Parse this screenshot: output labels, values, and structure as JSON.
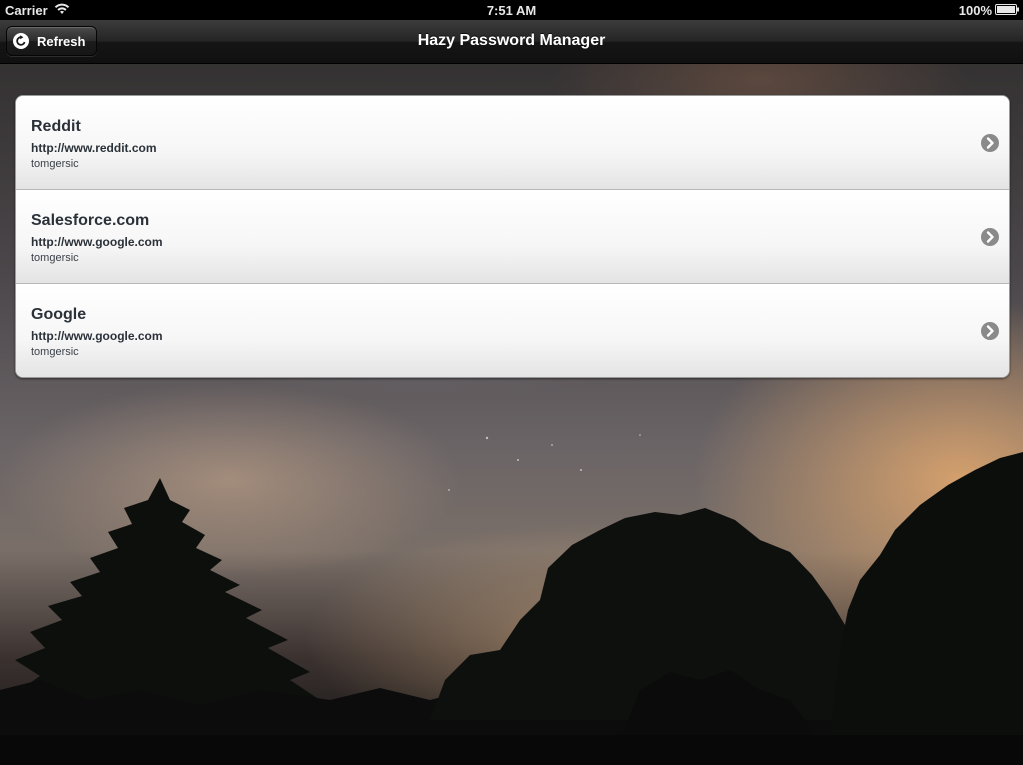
{
  "status_bar": {
    "carrier": "Carrier",
    "time": "7:51 AM",
    "battery": "100%",
    "wifi_icon": "wifi-icon",
    "battery_icon": "battery-icon"
  },
  "nav_bar": {
    "title": "Hazy Password Manager",
    "refresh_label": "Refresh",
    "refresh_icon": "refresh-icon"
  },
  "entries": [
    {
      "title": "Reddit",
      "url": "http://www.reddit.com",
      "username": "tomgersic"
    },
    {
      "title": "Salesforce.com",
      "url": "http://www.google.com",
      "username": "tomgersic"
    },
    {
      "title": "Google",
      "url": "http://www.google.com",
      "username": "tomgersic"
    }
  ],
  "colors": {
    "nav_bar": "#1e1e1e",
    "cell_text": "#2a3138",
    "disclosure": "#8a8a8a"
  }
}
